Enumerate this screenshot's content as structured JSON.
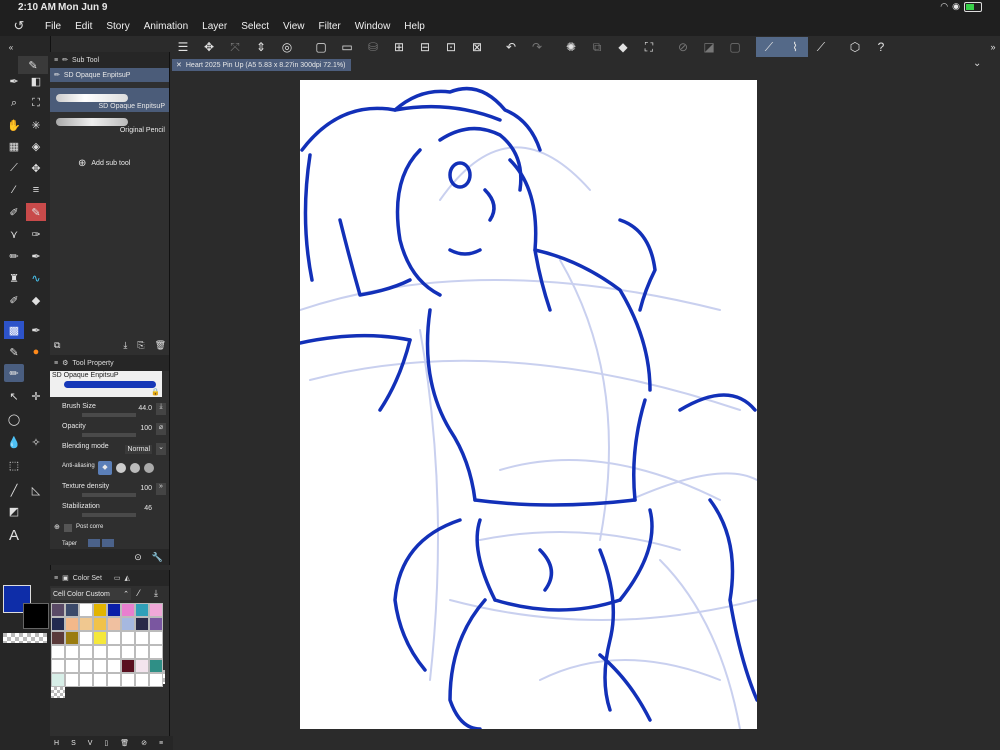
{
  "status_bar": {
    "time": "2:10 AM",
    "date": "Mon Jun 9"
  },
  "menu": [
    "File",
    "Edit",
    "Story",
    "Animation",
    "Layer",
    "Select",
    "View",
    "Filter",
    "Window",
    "Help"
  ],
  "sub_tool": {
    "tab_label": "Sub Tool",
    "group_label": "SD Opaque EnpitsuP",
    "brushes": [
      {
        "label": "SD Opaque EnpitsuP",
        "selected": true
      },
      {
        "label": "Original Pencil",
        "selected": false
      }
    ],
    "add_label": "Add sub tool"
  },
  "tool_property": {
    "tab_label": "Tool Property",
    "brush_name": "SD Opaque EnpitsuP",
    "brush_size": {
      "label": "Brush Size",
      "value": "44.0"
    },
    "opacity": {
      "label": "Opacity",
      "value": "100"
    },
    "blending_mode": {
      "label": "Blending mode",
      "value": "Normal"
    },
    "anti_aliasing": {
      "label": "Anti-aliasing"
    },
    "texture_density": {
      "label": "Texture density",
      "value": "100"
    },
    "stabilization": {
      "label": "Stabilization",
      "value": "46"
    },
    "post_correction": {
      "label": "Post corre"
    },
    "taper": {
      "label": "Taper"
    }
  },
  "color_set": {
    "tab_label": "Color Set",
    "set_name": "Cell Color Custom",
    "swatches": [
      "#5a4a66",
      "#3c4a6a",
      "#ffffff",
      "#e2b400",
      "#0a1ea8",
      "#e87fcf",
      "#30a0b8",
      "#f0a8d8",
      "#222a50",
      "#f3b88a",
      "#f0c890",
      "#f0c24a",
      "#f0c0a0",
      "#a6b8e0",
      "#2a2a48",
      "#7a56a0",
      "#5a3a3a",
      "#9a7c10",
      "#ffffff",
      "#f5e83a",
      "#ffffff",
      "#ffffff",
      "#ffffff",
      "#ffffff",
      "#ffffff",
      "#ffffff",
      "#ffffff",
      "#ffffff",
      "#ffffff",
      "#ffffff",
      "#ffffff",
      "#ffffff",
      "#ffffff",
      "#ffffff",
      "#ffffff",
      "#ffffff",
      "#ffffff",
      "#5a1020",
      "#f3e4ee",
      "#2f8f86",
      "#d8efe8",
      "#ffffff",
      "#ffffff",
      "#ffffff",
      "#ffffff",
      "#ffffff",
      "#ffffff",
      "#ffffff"
    ]
  },
  "document": {
    "tab_label": "Heart 2025 Pin Up (A5 5.83 x 8.27in 300dpi 72.1%)"
  },
  "colors": {
    "main": "#0e2da8",
    "sub": "#000000",
    "stroke": "#1230b8"
  }
}
